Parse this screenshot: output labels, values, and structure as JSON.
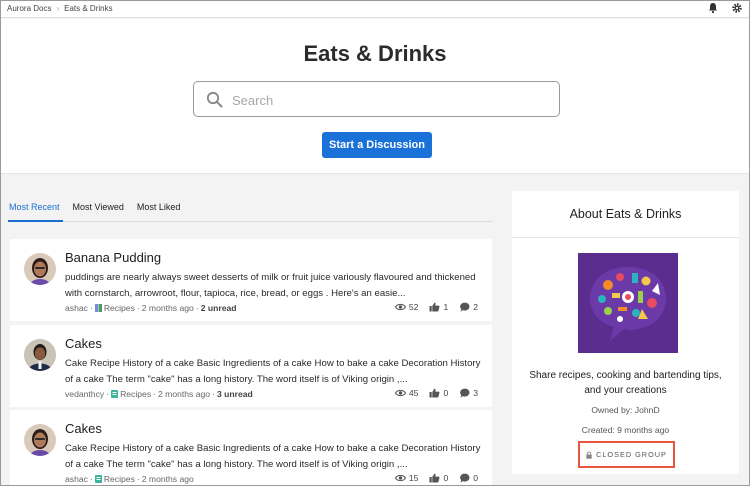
{
  "breadcrumb": {
    "home": "Aurora Docs",
    "current": "Eats & Drinks"
  },
  "topbar": {
    "icons": [
      "bell-icon",
      "gear-icon"
    ]
  },
  "hero": {
    "title": "Eats & Drinks",
    "search_placeholder": "Search",
    "search_value": "",
    "start_button": "Start a Discussion"
  },
  "tabs": [
    {
      "label": "Most Recent",
      "active": true
    },
    {
      "label": "Most Viewed",
      "active": false
    },
    {
      "label": "Most Liked",
      "active": false
    }
  ],
  "posts": [
    {
      "title": "Banana Pudding",
      "excerpt": "puddings are nearly always sweet desserts of  milk or fruit juice variously flavoured and thickened with cornstarch, arrowroot, flour, tapioca, rice, bread, or eggs . Here's an easie...",
      "author": "ashac",
      "board": "Recipes",
      "time": "2 months ago",
      "unread": "2 unread",
      "views": "52",
      "likes": "1",
      "replies": "2"
    },
    {
      "title": "Cakes",
      "excerpt": "Cake Recipe History of a cake Basic Ingredients of a cake How to bake a cake Decoration History of a cake The term \"cake\" has a long history. The word itself is of Viking origin ,...",
      "author": "vedanthcy",
      "board": "Recipes",
      "time": "2 months ago",
      "unread": "3 unread",
      "views": "45",
      "likes": "0",
      "replies": "3"
    },
    {
      "title": "Cakes",
      "excerpt": "Cake Recipe History of a cake Basic Ingredients of a cake How to bake a cake Decoration History of a cake The term \"cake\" has a long history. The word itself is of Viking origin ,...",
      "author": "ashac",
      "board": "Recipes",
      "time": "2 months ago",
      "unread": "",
      "views": "15",
      "likes": "0",
      "replies": "0"
    }
  ],
  "sidebar": {
    "title": "About Eats & Drinks",
    "description": "Share recipes, cooking and bartending tips, and your creations",
    "owner": "Owned by: JohnD",
    "created": "Created: 9 months ago",
    "badge": "CLOSED GROUP"
  },
  "colors": {
    "accent": "#1a72d8",
    "badge_border": "#e9553f",
    "group_image_bg": "#5a2d8f"
  }
}
